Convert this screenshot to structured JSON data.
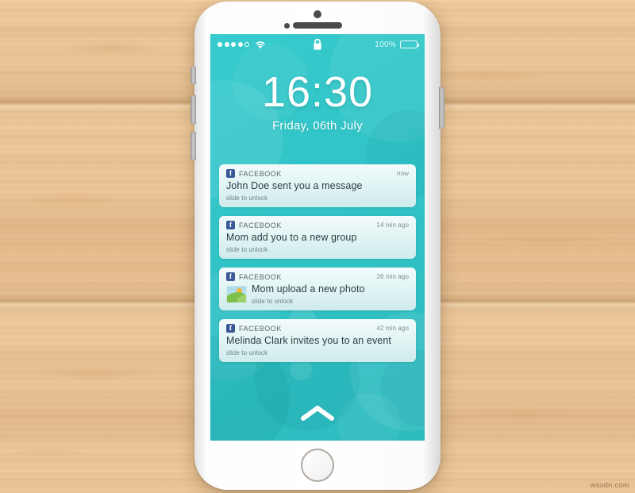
{
  "scene": {
    "background": "wood-planks",
    "wood_color": "#eec79a",
    "watermark": "wsxdn.com"
  },
  "phone": {
    "device": "smartphone-lockscreen-mockup",
    "body_color": "#ffffff",
    "hardware": {
      "earpiece": "earpiece-speaker",
      "front_camera": "front-camera",
      "proximity_sensor": "proximity-sensor",
      "home_button": "home-button",
      "power_button": "power-button",
      "volume_up": "volume-up-button",
      "volume_down": "volume-down-button",
      "silent_switch": "silent-switch"
    }
  },
  "screen": {
    "wallpaper_color": "#33c7c9",
    "status_bar": {
      "signal_dots_filled": 4,
      "signal_dots_total": 5,
      "wifi_icon": "wifi-icon",
      "lock_icon": "lock-icon",
      "battery_percent": "100%",
      "battery_level": 100
    },
    "clock": {
      "time": "16:30",
      "date": "Friday, 06th July"
    },
    "slide_up_hint_icon": "chevron-up-icon",
    "notifications": [
      {
        "app": "FACEBOOK",
        "app_icon": "facebook-icon",
        "icon_glyph": "f",
        "time": "now",
        "title": "John Doe sent you a message",
        "hint": "slide to unlock",
        "thumbnail": null
      },
      {
        "app": "FACEBOOK",
        "app_icon": "facebook-icon",
        "icon_glyph": "f",
        "time": "14 min ago",
        "title": "Mom add you to a new group",
        "hint": "slide to unlock",
        "thumbnail": null
      },
      {
        "app": "FACEBOOK",
        "app_icon": "facebook-icon",
        "icon_glyph": "f",
        "time": "26 min ago",
        "title": "Mom upload a new photo",
        "hint": "slide to unlock",
        "thumbnail": "photo-thumbnail"
      },
      {
        "app": "FACEBOOK",
        "app_icon": "facebook-icon",
        "icon_glyph": "f",
        "time": "42 min ago",
        "title": "Melinda Clark invites you to an event",
        "hint": "slide to unlock",
        "thumbnail": null
      }
    ]
  }
}
